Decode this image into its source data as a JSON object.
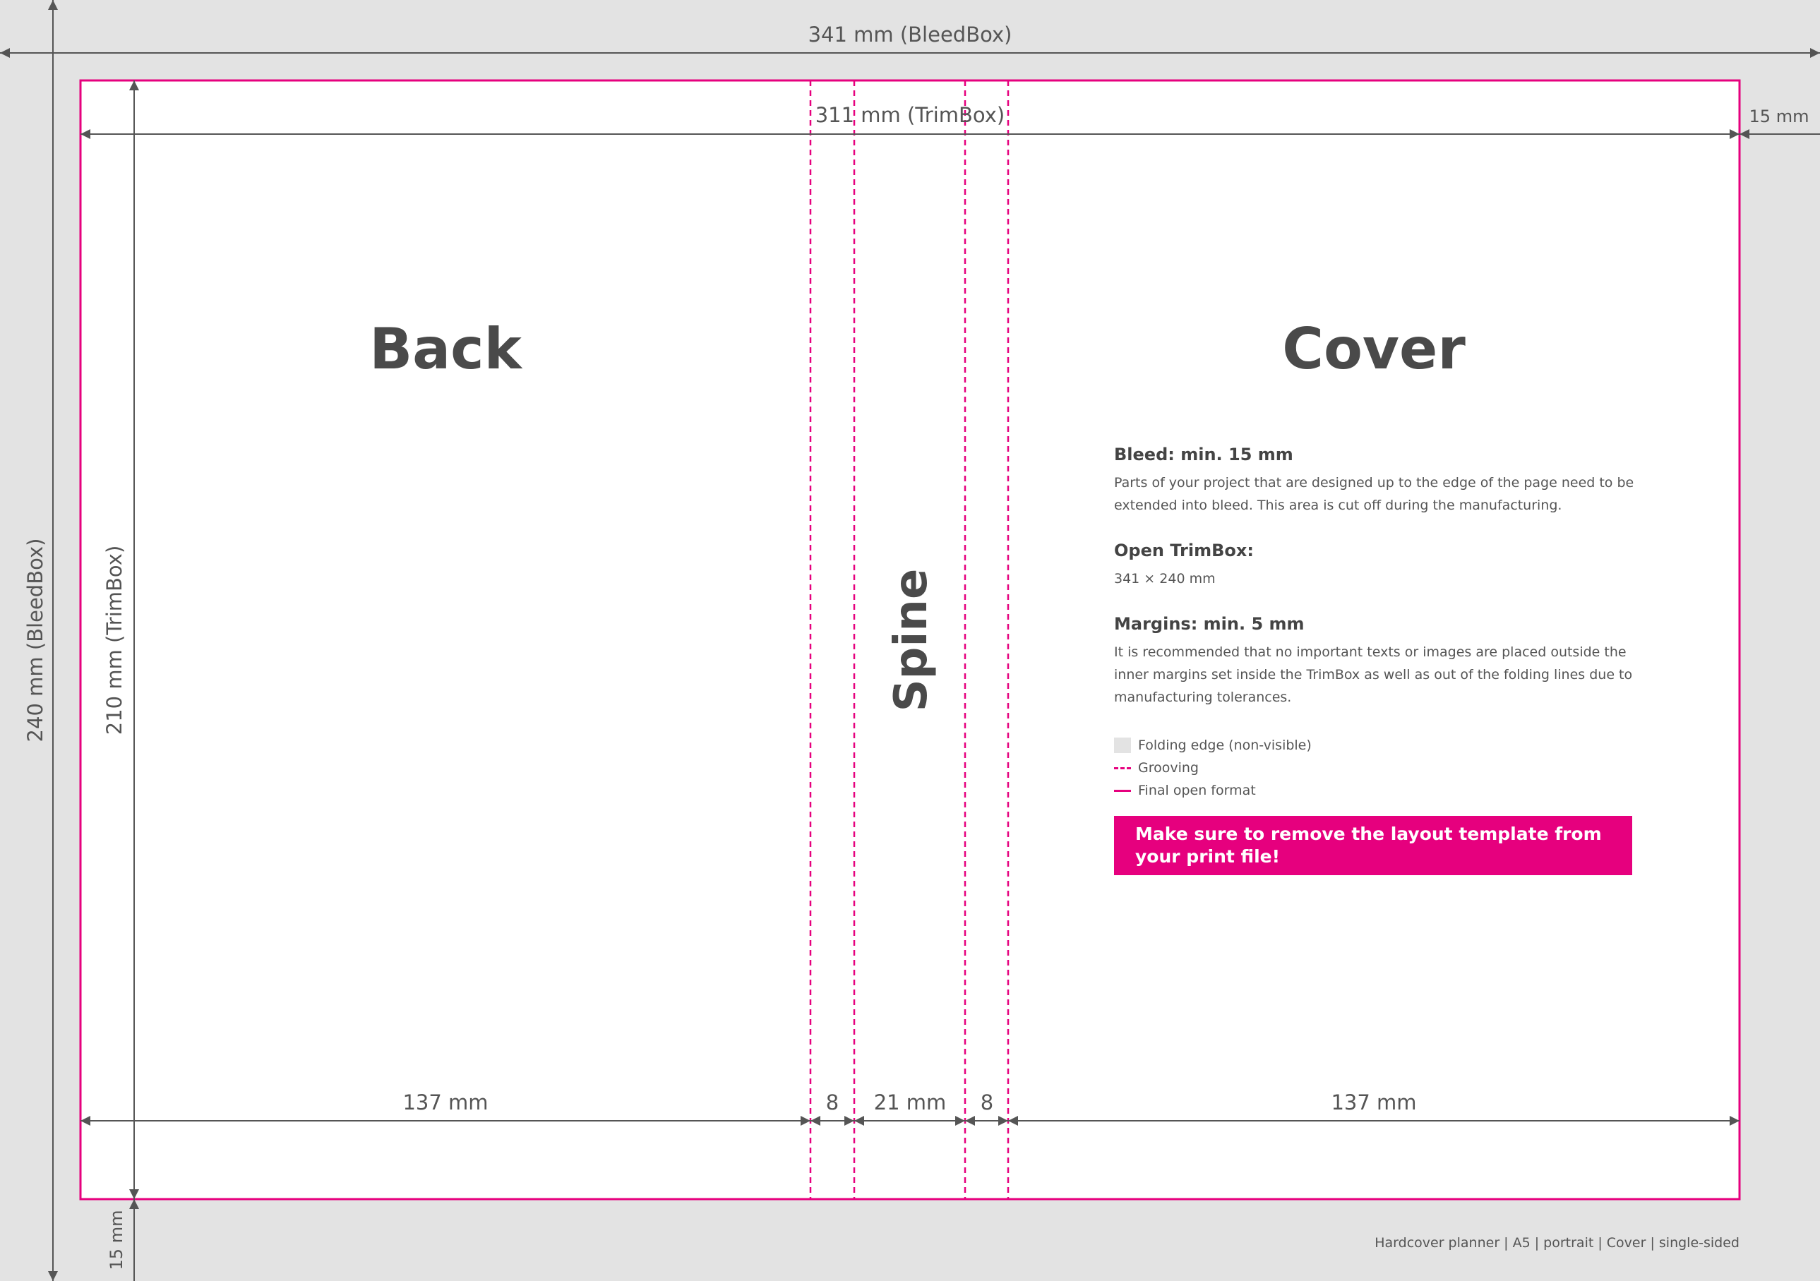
{
  "dimensions": {
    "bleedbox_width": "341 mm (BleedBox)",
    "trimbox_width": "311 mm (TrimBox)",
    "bleed_side": "15 mm",
    "bleedbox_height": "240 mm (BleedBox)",
    "trimbox_height": "210 mm (TrimBox)",
    "bleed_bottom": "15 mm",
    "back_width": "137 mm",
    "groove_left": "8",
    "spine_width": "21 mm",
    "groove_right": "8",
    "cover_width": "137 mm"
  },
  "panels": {
    "back": "Back",
    "spine": "Spine",
    "cover": "Cover"
  },
  "info": {
    "bleed_title": "Bleed: min. 15 mm",
    "bleed_text": "Parts of your project that are designed up to the edge of the page need to be extended into bleed. This area is cut off during the manufacturing.",
    "trimbox_title": "Open TrimBox:",
    "trimbox_text": "341 × 240 mm",
    "margins_title": "Margins: min. 5 mm",
    "margins_text": "It is recommended that no important texts or images are placed outside the inner margins set inside the TrimBox as well as out of the folding lines due to manufacturing tolerances."
  },
  "legend": {
    "folding_edge": "Folding edge (non-visible)",
    "grooving": "Grooving",
    "final_format": "Final open format"
  },
  "warning": "Make sure to remove the layout template from your print file!",
  "footer": "Hardcover planner  |  A5  |  portrait  |  Cover  |  single-sided",
  "colors": {
    "accent": "#e6007e",
    "background": "#e3e3e3",
    "page": "#ffffff",
    "text": "#4a4a4a"
  }
}
